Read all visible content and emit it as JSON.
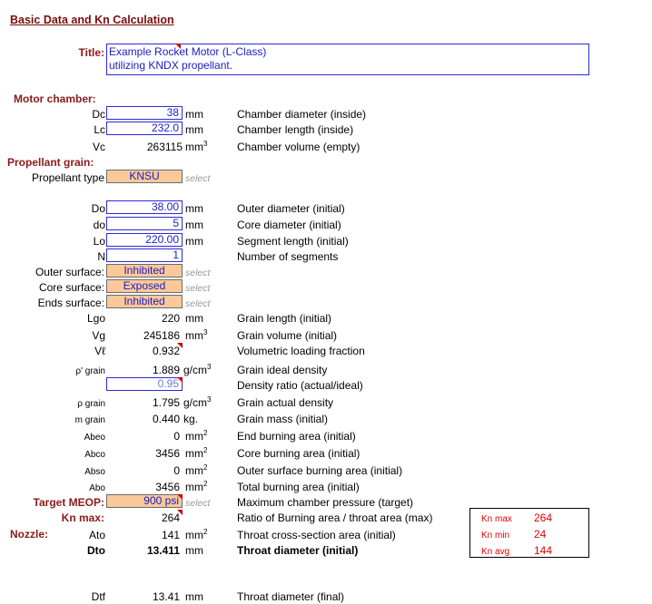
{
  "page_title": "Basic Data and Kn Calculation",
  "title": {
    "label": "Title:",
    "line1": "Example Rocket Motor (L-Class)",
    "line2": "utilizing KNDX propellant."
  },
  "motor_chamber": {
    "header": "Motor chamber:",
    "rows": [
      {
        "sym": "Dc",
        "value": "38",
        "unit": "mm",
        "desc": "Chamber diameter (inside)"
      },
      {
        "sym": "Lc",
        "value": "232.0",
        "unit": "mm",
        "desc": "Chamber length (inside)"
      },
      {
        "sym": "Vc",
        "value": "263115",
        "unit": "mm",
        "desc": "Chamber volume (empty)"
      }
    ]
  },
  "propellant_grain": {
    "header": "Propellant grain:",
    "type_label": "Propellant type",
    "type_value": "KNSU",
    "select_hint": "select"
  },
  "grain_inputs": [
    {
      "sym": "Do",
      "value": "38.00",
      "unit": "mm",
      "desc": "Outer diameter (initial)"
    },
    {
      "sym": "do",
      "value": "5",
      "unit": "mm",
      "desc": "Core diameter (initial)"
    },
    {
      "sym": "Lo",
      "value": "220.00",
      "unit": "mm",
      "desc": "Segment length (initial)"
    },
    {
      "sym": "N",
      "value": "1",
      "unit": "",
      "desc": "Number of segments"
    }
  ],
  "surfaces": [
    {
      "label": "Outer surface:",
      "value": "Inhibited"
    },
    {
      "label": "Core surface:",
      "value": "Exposed"
    },
    {
      "label": "Ends surface:",
      "value": "Inhibited"
    }
  ],
  "computed": {
    "lgo": {
      "sym": "Lgo",
      "value": "220",
      "unit": "mm",
      "desc": "Grain length (initial)"
    },
    "vg": {
      "sym": "Vg",
      "value": "245186",
      "unit": "mm",
      "desc": "Grain volume (initial)"
    },
    "vl": {
      "sym": "Vℓ",
      "value": "0.932",
      "desc": "Volumetric loading fraction"
    },
    "rho_ideal": {
      "sym": "ρ' grain",
      "value": "1.889",
      "unit": "g/cm",
      "desc": "Grain ideal density"
    },
    "density_ratio": {
      "value": "0.95",
      "desc": "Density ratio (actual/ideal)"
    },
    "rho_actual": {
      "sym": "ρ grain",
      "value": "1.795",
      "unit": "g/cm",
      "desc": "Grain actual density"
    },
    "mass": {
      "sym": "m grain",
      "value": "0.440",
      "unit": "kg.",
      "desc": "Grain mass (initial)"
    },
    "abeo": {
      "sym": "Abeo",
      "value": "0",
      "unit": "mm",
      "desc": "End burning area (initial)"
    },
    "abco": {
      "sym": "Abco",
      "value": "3456",
      "unit": "mm",
      "desc": "Core burning area (initial)"
    },
    "abso": {
      "sym": "Abso",
      "value": "0",
      "unit": "mm",
      "desc": "Outer surface burning area (initial)"
    },
    "abo": {
      "sym": "Abo",
      "value": "3456",
      "unit": "mm",
      "desc": "Total burning area (initial)"
    }
  },
  "meop": {
    "label": "Target MEOP:",
    "value": "900 psi",
    "desc": "Maximum chamber pressure (target)"
  },
  "knmax": {
    "label": "Kn max:",
    "value": "264",
    "desc": "Ratio of Burning area / throat area  (max)"
  },
  "nozzle": {
    "header": "Nozzle:",
    "ato": {
      "sym": "Ato",
      "value": "141",
      "unit": "mm",
      "desc": "Throat cross-section area (initial)"
    },
    "dto": {
      "sym": "Dto",
      "value": "13.411",
      "unit": "mm",
      "desc": "Throat diameter (initial)"
    },
    "dtf": {
      "sym": "Dtf",
      "value": "13.41",
      "unit": "mm",
      "desc": "Throat diameter (final)"
    }
  },
  "kn_summary": [
    {
      "label": "Kn max",
      "value": "264"
    },
    {
      "label": "Kn min",
      "value": "24"
    },
    {
      "label": "Kn avg",
      "value": "144"
    }
  ],
  "superscripts": {
    "sq": "2",
    "cube": "3"
  },
  "colors": {
    "section": "#8b1a1a",
    "input_text": "#1c1cc8",
    "select_fill": "#fbc999",
    "kn_red": "#e00000"
  }
}
